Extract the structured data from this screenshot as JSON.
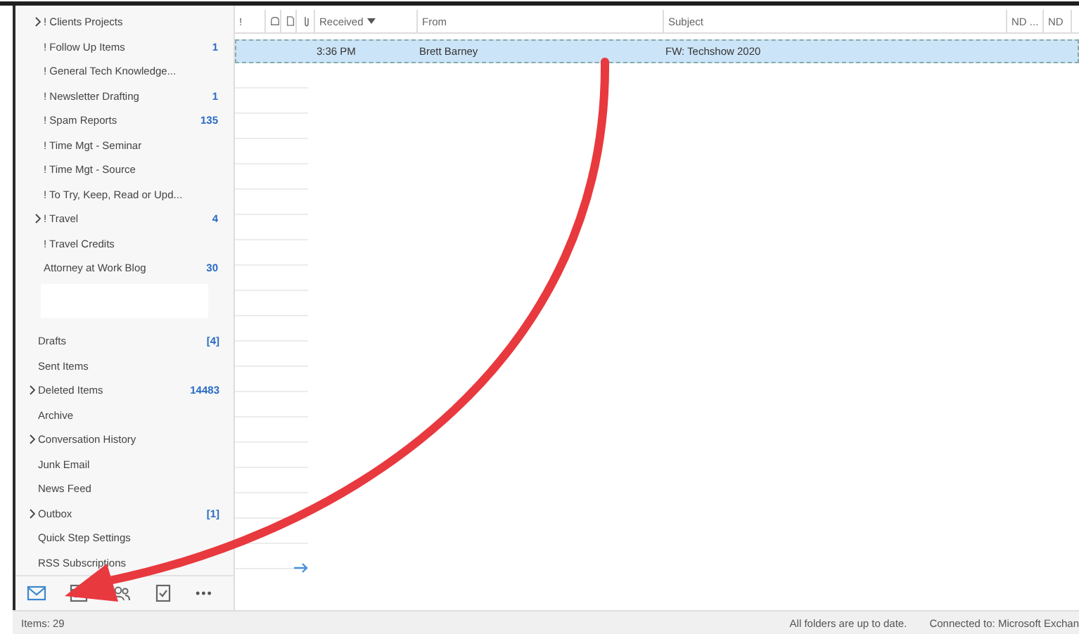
{
  "subfolders": [
    {
      "label": "! Clients Projects",
      "has_children": true
    },
    {
      "label": "! Follow Up Items",
      "count": "1",
      "has_children": false
    },
    {
      "label": "! General Tech Knowledge...",
      "has_children": false
    },
    {
      "label": "! Newsletter Drafting",
      "count": "1",
      "has_children": false
    },
    {
      "label": "! Spam Reports",
      "count": "135",
      "has_children": false
    },
    {
      "label": "! Time Mgt - Seminar",
      "has_children": false
    },
    {
      "label": "! Time Mgt - Source",
      "has_children": false
    },
    {
      "label": "! To Try, Keep, Read or Upd...",
      "has_children": false
    },
    {
      "label": "! Travel",
      "count": "4",
      "has_children": true
    },
    {
      "label": "! Travel Credits",
      "has_children": false
    },
    {
      "label": "Attorney at Work Blog",
      "count": "30",
      "has_children": false
    }
  ],
  "folders": [
    {
      "label": "Drafts",
      "count": "[4]",
      "has_children": false
    },
    {
      "label": "Sent Items",
      "has_children": false
    },
    {
      "label": "Deleted Items",
      "count": "14483",
      "has_children": true
    },
    {
      "label": "Archive",
      "has_children": false
    },
    {
      "label": "Conversation History",
      "has_children": true
    },
    {
      "label": "Junk Email",
      "has_children": false
    },
    {
      "label": "News Feed",
      "has_children": false
    },
    {
      "label": "Outbox",
      "count": "[1]",
      "has_children": true
    },
    {
      "label": "Quick Step Settings",
      "has_children": false
    },
    {
      "label": "RSS Subscriptions",
      "has_children": false
    }
  ],
  "nav": [
    {
      "kind": "mail",
      "selected": true
    },
    {
      "kind": "calendar",
      "selected": false
    },
    {
      "kind": "people",
      "selected": false
    },
    {
      "kind": "tasks",
      "selected": false
    },
    {
      "kind": "more",
      "label": "•••",
      "selected": false
    }
  ],
  "table": {
    "columns": [
      {
        "kind": "text",
        "label": "!"
      },
      {
        "kind": "reminder"
      },
      {
        "kind": "document"
      },
      {
        "kind": "attachment"
      },
      {
        "kind": "text",
        "label": "Received",
        "sorted": true
      },
      {
        "kind": "text",
        "label": "From"
      },
      {
        "kind": "text",
        "label": "Subject"
      },
      {
        "kind": "text",
        "label": "ND ..."
      },
      {
        "kind": "text",
        "label": "ND"
      }
    ],
    "rows": [
      {
        "selected": true,
        "received": "3:36 PM",
        "from": "Brett Barney",
        "subject": "FW: Techshow 2020"
      }
    ]
  },
  "status_bar": {
    "items": "Items: 29",
    "sync": "All folders are up to date.",
    "connection": "Connected to: Microsoft Exchan"
  }
}
